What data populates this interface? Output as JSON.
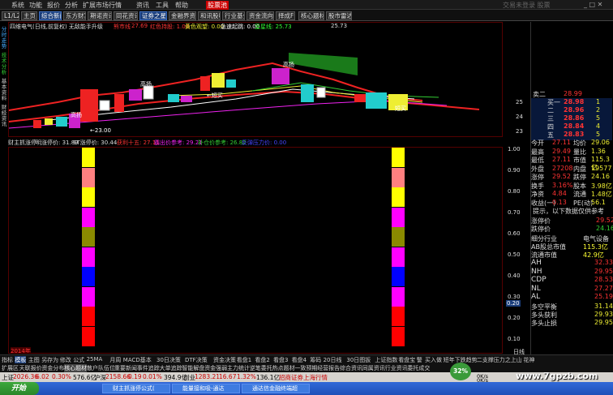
{
  "menu": {
    "items": [
      "系统",
      "功能",
      "报价",
      "分析",
      "扩展市场行情",
      "资讯",
      "工具",
      "帮助"
    ],
    "active": "股票池",
    "right": "交易未登录 股票"
  },
  "toolbar": {
    "items": [
      "L1/L2",
      "主页",
      "综合新闻",
      "东方财富",
      "期诺资讯",
      "同花资讯",
      "证券之星",
      "金融界资讯",
      "和讯股吧",
      "行业基金",
      "资金流向",
      "择成F9",
      "核心题材",
      "股市雷达"
    ],
    "highlighted": [
      "综合新闻",
      "证券之星"
    ]
  },
  "main_header": {
    "name": "四维电气(日线,前复权) 无敌能手升级",
    "indicator": "熊市线",
    "val1": "27.69",
    "red_label": "红色持股: 1.00",
    "yellow_label": "黄色观望: 0.00",
    "buy_label": "急速起跳: 0.00",
    "green_label": "呈星线: 25.73",
    "last": "25.73"
  },
  "left_labels": [
    "分时走势",
    "技术分析",
    "基本资料",
    "财经资讯"
  ],
  "chart_data": {
    "type": "candlestick",
    "title": "四维电气(日线,前复权)",
    "price_ticks": [
      25.0,
      24.0,
      23.0
    ],
    "annotations": [
      {
        "text": "高扬"
      },
      {
        "text": "高扬"
      },
      {
        "text": "高扬"
      },
      {
        "text": "←短买"
      },
      {
        "text": "短买"
      },
      {
        "text": "←23.00"
      }
    ]
  },
  "ind_header": {
    "name": "财主抓涨停",
    "l1": "明涨停价: 31.89",
    "l2": "ST涨停价: 30.44",
    "l3": "获利十五: 27.11",
    "l4": "霸出价参考: 29.21",
    "l5": "补仓价参考: 26.82",
    "l6": "反弹压力价: 0.00"
  },
  "ind_ticks": [
    "1.00",
    "0.90",
    "0.80",
    "0.70",
    "0.60",
    "0.50",
    "0.40",
    "0.30",
    "0.20",
    "0.10"
  ],
  "ind_marker": "0.20",
  "ind_year": "2014年",
  "bar_colors": [
    "#ffff00",
    "#ff8080",
    "#ffff00",
    "#ff00ff",
    "#8a8a00",
    "#ff00ff",
    "#0000ff",
    "#ff00ff",
    "#ff0000",
    "#ff0000"
  ],
  "info": {
    "top_pair": [
      {
        "l": "卖二",
        "v": "28.99",
        "c": "#f33"
      },
      {
        "l": "买三",
        "v": "28.98",
        "c": "#fff"
      }
    ],
    "orders": [
      {
        "l": "买一",
        "p": "28.98",
        "v": "1",
        "c": "#f33"
      },
      {
        "l": "二",
        "p": "28.96",
        "v": "2",
        "c": "#f33"
      },
      {
        "l": "三",
        "p": "28.86",
        "v": "5",
        "c": "#f33"
      },
      {
        "l": "四",
        "p": "28.84",
        "v": "4",
        "c": "#f33"
      },
      {
        "l": "五",
        "p": "28.83",
        "v": "5",
        "c": "#f33"
      }
    ],
    "side_nums": [
      "146",
      "5",
      "4",
      "5"
    ],
    "stats": [
      {
        "a": "今开",
        "av": "27.11",
        "b": "均价",
        "bv": "29.06"
      },
      {
        "a": "最高",
        "av": "29.49",
        "b": "量比",
        "bv": "1.36"
      },
      {
        "a": "最低",
        "av": "27.11",
        "b": "市值",
        "bv": "115.3亿"
      },
      {
        "a": "外盘",
        "av": "27208",
        "b": "内盘",
        "bv": "19577"
      },
      {
        "a": "涨停",
        "av": "29.52",
        "b": "跌停",
        "bv": "24.16"
      },
      {
        "a": "换手",
        "av": "3.16%",
        "b": "股本",
        "bv": "3.98亿"
      },
      {
        "a": "净资",
        "av": "4.84",
        "b": "流通",
        "bv": "1.48亿"
      },
      {
        "a": "收益(一)",
        "av": "0.13",
        "b": "PE(动)",
        "bv": "56.1"
      }
    ],
    "tip": "提示，以下数据仅供参考",
    "prices": [
      {
        "l": "涨停价",
        "v": "29.52"
      },
      {
        "l": "跌停价",
        "v": "24.16"
      }
    ],
    "industry": [
      {
        "l": "细分行业",
        "v": "电气设备",
        "c": "#ddd"
      },
      {
        "l": "AB股总市值",
        "v": "115.3亿",
        "c": "#ffff33"
      },
      {
        "l": "流通市值",
        "v": "42.9亿",
        "c": "#ffff33"
      }
    ],
    "markets": [
      {
        "l": "AH",
        "v": "32.33"
      },
      {
        "l": "NH",
        "v": "29.95"
      },
      {
        "l": "CDP",
        "v": "28.53"
      },
      {
        "l": "NL",
        "v": "27.27"
      },
      {
        "l": "AL",
        "v": "25.19"
      }
    ],
    "bottom": [
      {
        "l": "多空平衡",
        "v": "31.14"
      },
      {
        "l": "多头获利",
        "v": "29.93"
      },
      {
        "l": "多头止损",
        "v": "29.95"
      }
    ]
  },
  "tabs1": [
    "指标",
    "模板",
    "主图",
    "另存为",
    "修改",
    "公式",
    "25MA",
    "月周",
    "MACD基本",
    "30日决策",
    "DTF决策",
    "资金决策",
    "看盘1",
    "看盘2",
    "看盘3",
    "看盘4",
    "筹码",
    "20日线",
    "30日图扳",
    "上证指数",
    "看盘宝",
    "警",
    "买入做",
    "短年下跌趋势",
    "二支撑压力",
    "之上山",
    "花神"
  ],
  "tabs2": [
    "扩展区",
    "天联报价",
    "资金分布",
    "核心题材",
    "散户队伍位",
    "重要新闻",
    "事件追踪",
    "大单追踪",
    "智能解盘",
    "资金强弱",
    "主力统计",
    "逆笔委托",
    "热点题材",
    "一致预期",
    "经营报告",
    "综合资讯",
    "同属资讯",
    "行业资讯",
    "委托成交"
  ],
  "tabs2_selected": "核心题材",
  "status": {
    "sh_label": "上证",
    "sh_val": "2026.36",
    "sh_chg": "6.02",
    "sh_pct": "0.30%",
    "sh_amt": "576.6亿",
    "sz_label": "沪深",
    "sz_val": "2158.66",
    "sz_chg": "0.19",
    "sz_pct": "0.01%",
    "sz_amt": "394.9亿",
    "cy_label": "创业",
    "cy_val": "1283.21",
    "cy_chg": "16.67",
    "cy_pct": "1.32%",
    "cy_amt": "136.1亿",
    "broker": "招商证券上海行情",
    "badge": "32%",
    "speed1": "0K/s",
    "speed2": "0K/s"
  },
  "taskbar": {
    "start": "开始",
    "tasks": [
      "财主抓涨停公式(",
      "能量接和吸-通达",
      "通达信金融终端超"
    ],
    "watermark": "www.7gpzb.com",
    "right_label": "日线"
  }
}
